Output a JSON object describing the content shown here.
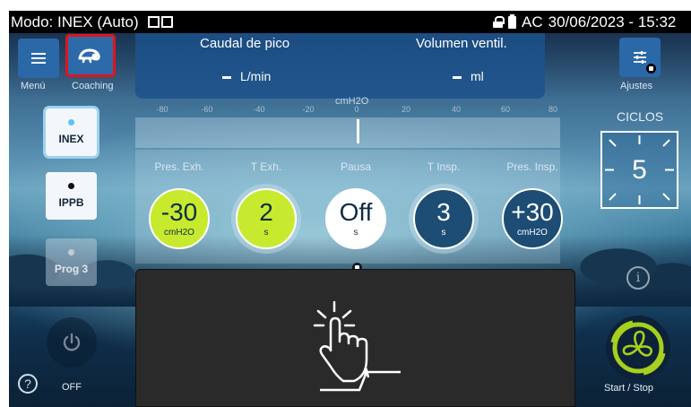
{
  "status_bar": {
    "mode": "Modo: INEX (Auto)",
    "power": "AC",
    "datetime": "30/06/2023 - 15:32"
  },
  "menu": {
    "label": "Menú",
    "icon": "hamburger-icon"
  },
  "coaching": {
    "label": "Coaching",
    "icon": "chameleon-icon",
    "highlight_color": "#e0141b"
  },
  "metrics": {
    "peak_flow": {
      "label": "Caudal de pico",
      "value": "-",
      "unit": "L/min"
    },
    "volume": {
      "label": "Volumen ventil.",
      "value": "-",
      "unit": "ml"
    }
  },
  "settings": {
    "label": "Ajustes",
    "icon": "sliders-icon"
  },
  "modes": [
    {
      "label": "INEX",
      "state": "selected"
    },
    {
      "label": "IPPB",
      "state": "available"
    },
    {
      "label": "Prog 3",
      "state": "disabled"
    }
  ],
  "scale": {
    "unit": "cmH2O",
    "ticks": [
      "-80",
      "-60",
      "-40",
      "-20",
      "0",
      "20",
      "40",
      "60",
      "80"
    ],
    "min": -80,
    "max": 80,
    "current": 0
  },
  "parameters": [
    {
      "label": "Pres. Exh.",
      "value": "-30",
      "unit": "cmH2O",
      "style": "green"
    },
    {
      "label": "T Exh.",
      "value": "2",
      "unit": "s",
      "style": "green"
    },
    {
      "label": "Pausa",
      "value": "Off",
      "unit": "s",
      "style": "white"
    },
    {
      "label": "T Insp.",
      "value": "3",
      "unit": "s",
      "style": "navy"
    },
    {
      "label": "Pres. Insp.",
      "value": "+30",
      "unit": "cmH2O",
      "style": "navy"
    }
  ],
  "cycles": {
    "label": "CICLOS",
    "value": "5"
  },
  "start_stop": {
    "label": "Start / Stop",
    "accent": "#a6cf1e"
  },
  "power_button": {
    "label": "OFF"
  },
  "help": {
    "glyph": "?"
  },
  "info": {
    "glyph": "i"
  },
  "colors": {
    "accent_green": "#c8ea2e",
    "panel_blue": "#1c528c",
    "knob_navy": "#1d4c74"
  }
}
